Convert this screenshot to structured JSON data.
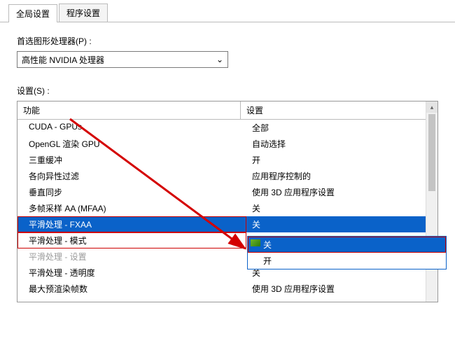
{
  "tabs": {
    "global": "全局设置",
    "program": "程序设置"
  },
  "processor": {
    "label": "首选图形处理器(P) :",
    "value": "高性能 NVIDIA 处理器"
  },
  "settings": {
    "label": "设置(S) :",
    "header_feature": "功能",
    "header_setting": "设置",
    "rows": [
      {
        "feature": "CUDA - GPUs",
        "value": "全部"
      },
      {
        "feature": "OpenGL 渲染 GPU",
        "value": "自动选择"
      },
      {
        "feature": "三重缓冲",
        "value": "开"
      },
      {
        "feature": "各向异性过滤",
        "value": "应用程序控制的"
      },
      {
        "feature": "垂直同步",
        "value": "使用 3D 应用程序设置"
      },
      {
        "feature": "多帧采样 AA (MFAA)",
        "value": "关"
      },
      {
        "feature": "平滑处理 - FXAA",
        "value": "关",
        "selected": true
      },
      {
        "feature": "平滑处理 - 模式",
        "value": ""
      },
      {
        "feature": "平滑处理 - 设置",
        "value": "",
        "dim": true
      },
      {
        "feature": "平滑处理 - 透明度",
        "value": "关"
      },
      {
        "feature": "最大预渲染帧数",
        "value": "使用 3D 应用程序设置"
      }
    ]
  },
  "dropdown": {
    "selected": "关",
    "hl": "关",
    "options": [
      "关",
      "开"
    ]
  }
}
